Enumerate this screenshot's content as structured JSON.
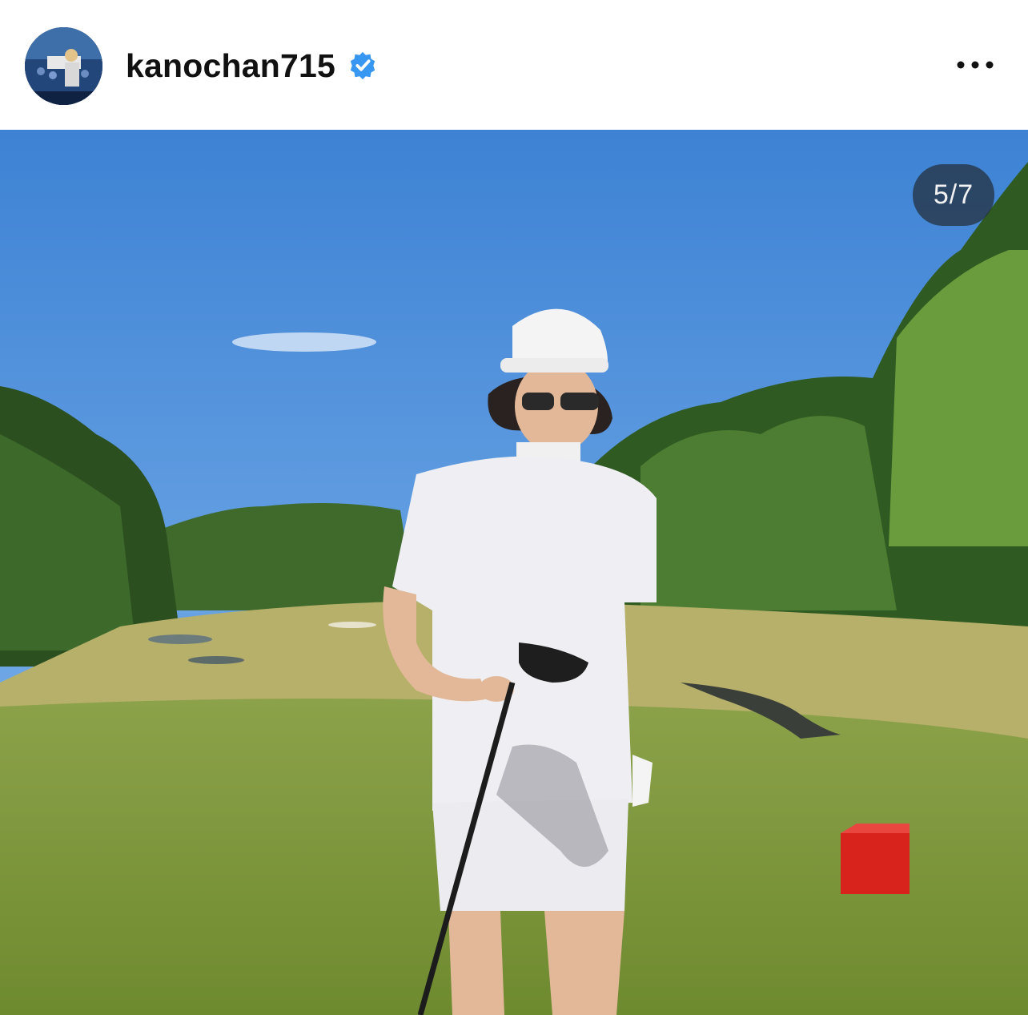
{
  "post": {
    "username": "kanochan715",
    "verified": true,
    "avatar_icon": "profile-avatar",
    "more_icon": "more-horizontal-icon",
    "carousel": {
      "current": 5,
      "total": 7,
      "label": "5/7"
    }
  },
  "colors": {
    "verified_blue": "#3897f0",
    "counter_bg": "#2e3740",
    "sky": "#4e8fd6",
    "fairway": "#7a9a3a"
  }
}
